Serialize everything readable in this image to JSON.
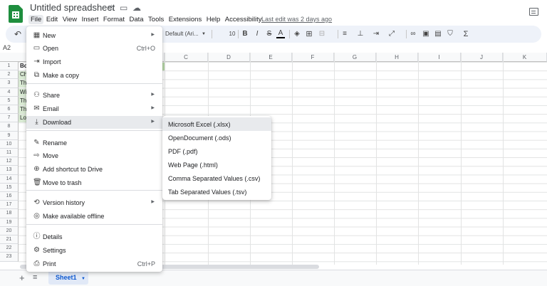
{
  "header": {
    "title": "Untitled spreadsheet",
    "last_edit": "Last edit was 2 days ago",
    "menus": [
      "File",
      "Edit",
      "View",
      "Insert",
      "Format",
      "Data",
      "Tools",
      "Extensions",
      "Help",
      "Accessibility"
    ]
  },
  "toolbar": {
    "font_name": "Default (Ari...",
    "font_size": "10",
    "bold": "B",
    "italic": "I",
    "strike": "S",
    "text_color": "A",
    "sigma": "Σ"
  },
  "formula_bar": {
    "cell_ref": "A2"
  },
  "grid": {
    "columns": [
      "C",
      "D",
      "E",
      "F",
      "G",
      "H",
      "I",
      "J",
      "K"
    ],
    "rows": [
      "1",
      "2",
      "3",
      "4",
      "5",
      "6",
      "7",
      "8",
      "9",
      "10",
      "11",
      "12",
      "13",
      "14",
      "15",
      "16",
      "17",
      "18",
      "19",
      "20",
      "21",
      "22",
      "23"
    ],
    "cell_snippets": [
      "Bo",
      "Ch",
      "Th",
      "Wi",
      "Th",
      "Th",
      "Lo"
    ]
  },
  "sheets": {
    "add": "+",
    "list": "≡",
    "active_tab": "Sheet1"
  },
  "file_menu": {
    "items": [
      {
        "icon": "new-icon",
        "label": "New",
        "submenu": true
      },
      {
        "icon": "open-icon",
        "label": "Open",
        "shortcut": "Ctrl+O"
      },
      {
        "icon": "import-icon",
        "label": "Import"
      },
      {
        "icon": "copy-icon",
        "label": "Make a copy"
      },
      {
        "icon": "share-icon",
        "label": "Share",
        "submenu": true
      },
      {
        "icon": "email-icon",
        "label": "Email",
        "submenu": true
      },
      {
        "icon": "download-icon",
        "label": "Download",
        "submenu": true
      },
      {
        "icon": "rename-icon",
        "label": "Rename"
      },
      {
        "icon": "move-icon",
        "label": "Move"
      },
      {
        "icon": "shortcut-icon",
        "label": "Add shortcut to Drive"
      },
      {
        "icon": "trash-icon",
        "label": "Move to trash"
      },
      {
        "icon": "history-icon",
        "label": "Version history",
        "submenu": true
      },
      {
        "icon": "offline-icon",
        "label": "Make available offline"
      },
      {
        "icon": "details-icon",
        "label": "Details"
      },
      {
        "icon": "settings-icon",
        "label": "Settings"
      },
      {
        "icon": "print-icon",
        "label": "Print",
        "shortcut": "Ctrl+P"
      }
    ]
  },
  "download_menu": {
    "items": [
      "Microsoft Excel (.xlsx)",
      "OpenDocument (.ods)",
      "PDF (.pdf)",
      "Web Page (.html)",
      "Comma Separated Values (.csv)",
      "Tab Separated Values (.tsv)"
    ]
  },
  "colors": {
    "accent": "#0b57d0",
    "brand_green": "#1e8e3e",
    "selected_cell": "#d9ead3"
  }
}
